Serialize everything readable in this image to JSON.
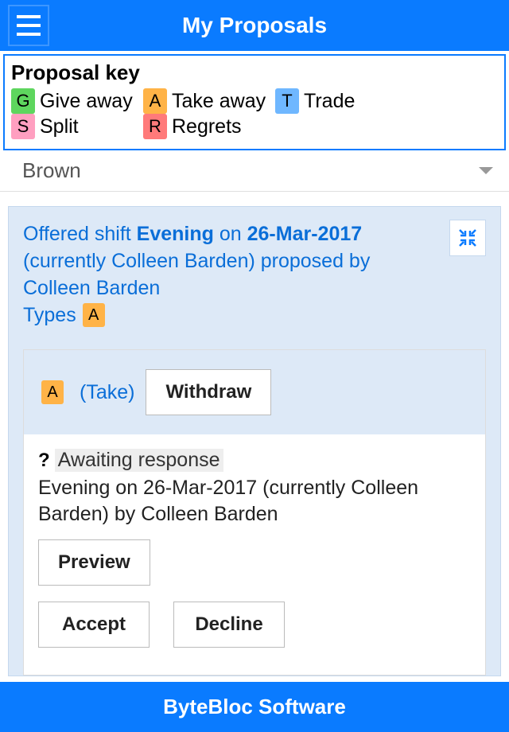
{
  "header": {
    "title": "My Proposals"
  },
  "key": {
    "title": "Proposal key",
    "items": [
      {
        "code": "G",
        "label": "Give away",
        "badge": "badge-g"
      },
      {
        "code": "A",
        "label": "Take away",
        "badge": "badge-a"
      },
      {
        "code": "T",
        "label": "Trade",
        "badge": "badge-t"
      },
      {
        "code": "S",
        "label": "Split",
        "badge": "badge-s"
      },
      {
        "code": "R",
        "label": "Regrets",
        "badge": "badge-r"
      }
    ]
  },
  "selector": {
    "value": "Brown"
  },
  "proposal": {
    "offered_prefix": "Offered shift ",
    "shift_name": "Evening",
    "on_text": " on ",
    "date": "26-Mar-2017",
    "currently_text": " (currently Colleen Barden) proposed by Colleen Barden",
    "types_label": "Types",
    "type_code": "A",
    "take": {
      "code": "A",
      "label": "(Take)",
      "withdraw_label": "Withdraw"
    },
    "status": {
      "q": "?",
      "text": "Awaiting response",
      "detail": "Evening on 26-Mar-2017 (currently Colleen Barden) by Colleen Barden"
    },
    "buttons": {
      "preview": "Preview",
      "accept": "Accept",
      "decline": "Decline"
    }
  },
  "footer": {
    "text": "ByteBloc Software"
  }
}
